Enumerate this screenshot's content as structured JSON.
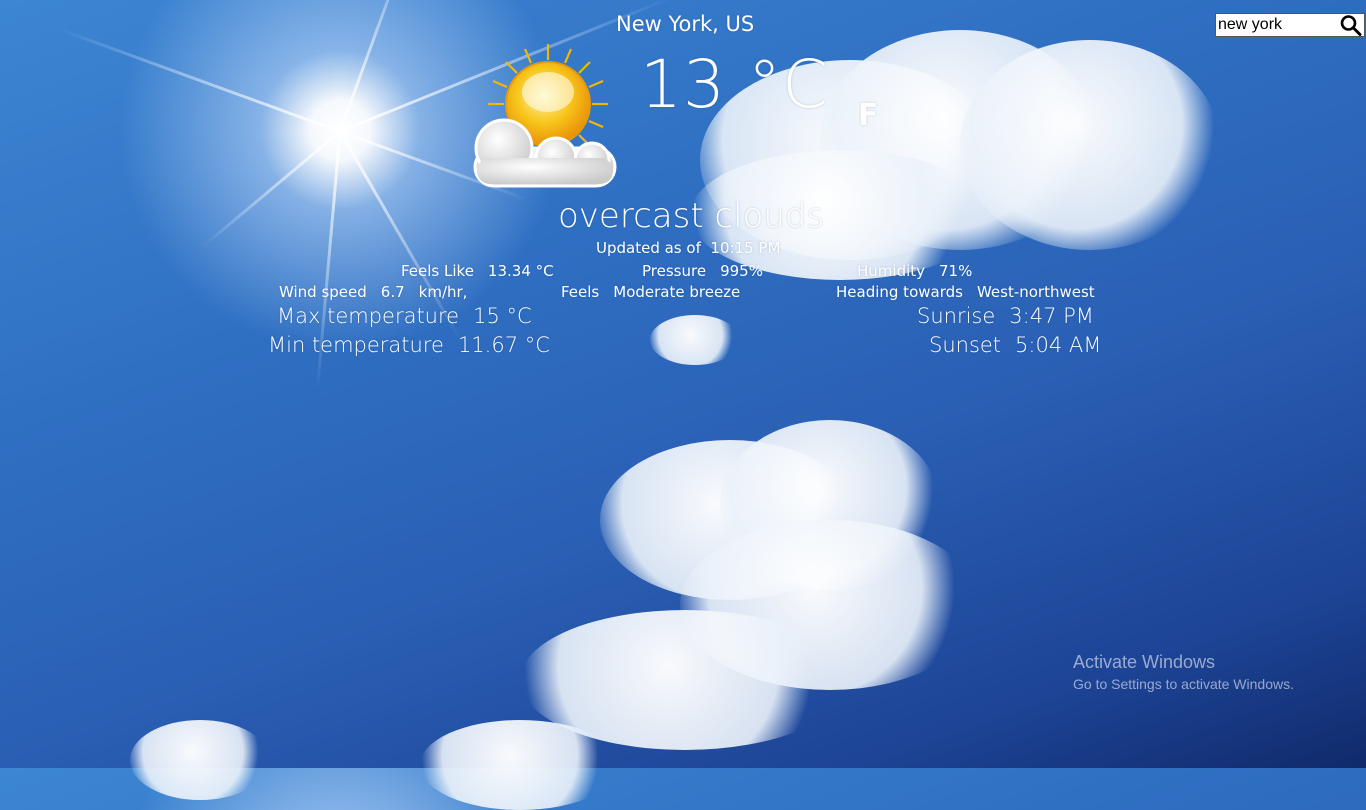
{
  "search": {
    "value": "new york",
    "icon": "search-icon"
  },
  "location": "New York, US",
  "temperature": "13 °C",
  "unit_toggle": "F",
  "condition": {
    "text": "overcast clouds",
    "icon": "sun-behind-clouds-icon"
  },
  "updated": {
    "label": "Updated as of",
    "time": "10:15 PM"
  },
  "feels_like": {
    "label": "Feels Like",
    "value": "13.34 °C"
  },
  "pressure": {
    "label": "Pressure",
    "value": "995%"
  },
  "humidity": {
    "label": "Humidity",
    "value": "71%"
  },
  "wind": {
    "label": "Wind speed",
    "value": "6.7",
    "unit": "km/hr,",
    "feels_label": "Feels",
    "feels_value": "Moderate breeze",
    "heading_label": "Heading towards",
    "heading_value": "West-northwest"
  },
  "max_temp": {
    "label": "Max temperature",
    "value": "15 °C"
  },
  "min_temp": {
    "label": "Min temperature",
    "value": "11.67 °C"
  },
  "sunrise": {
    "label": "Sunrise",
    "value": "3:47 PM"
  },
  "sunset": {
    "label": "Sunset",
    "value": "5:04 AM"
  },
  "watermark": {
    "title": "Activate Windows",
    "subtitle": "Go to Settings to activate Windows."
  }
}
